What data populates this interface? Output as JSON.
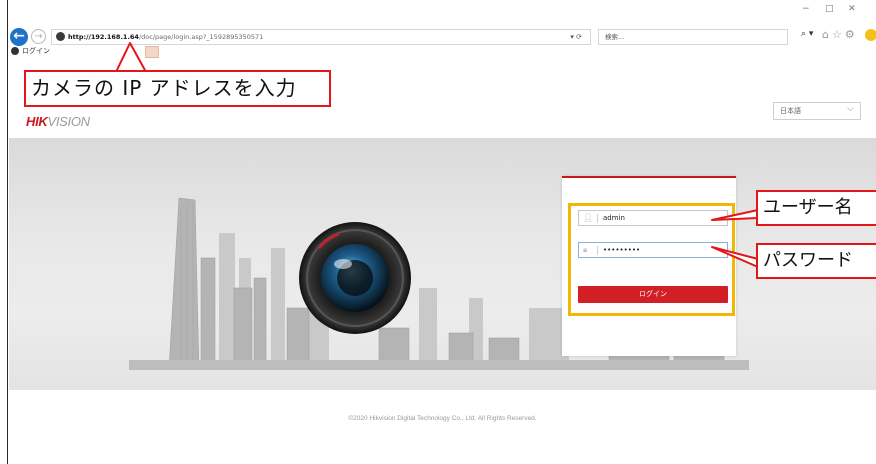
{
  "browser": {
    "url_host": "http://192.168.1.64",
    "url_path": "/doc/page/login.asp?_1592895350571",
    "address_actions": "▾ ⟳",
    "search_placeholder": "検索...",
    "search_glyph": "⌕ ▾",
    "tab_label": "ログイン",
    "minimize": "−",
    "restore": "□",
    "close": "✕",
    "toolbar_glyphs": "⌂☆⚙"
  },
  "page": {
    "logo_main": "HIK",
    "logo_rest": "VISION",
    "language_selected": "日本語",
    "language_chevron": "⌵",
    "username_value": "admin",
    "password_value": "•••••••••",
    "login_button": "ログイン",
    "copyright": "©2020 Hikvision Digital Technology Co., Ltd. All Rights Reserved."
  },
  "annotations": {
    "ip_callout": "カメラの IP アドレスを入力",
    "user_callout": "ユーザー名",
    "password_callout": "パスワード"
  },
  "colors": {
    "brand_red": "#c8171e",
    "callout_border": "#e3161b",
    "highlight": "#f2b705",
    "browser_blue": "#1e73c8"
  },
  "icons": [
    "back-arrow-icon",
    "forward-arrow-icon",
    "site-icon",
    "refresh-icon",
    "search-icon",
    "home-icon",
    "star-icon",
    "gear-icon",
    "smiley-icon",
    "user-icon",
    "lock-icon",
    "chevron-down-icon"
  ]
}
